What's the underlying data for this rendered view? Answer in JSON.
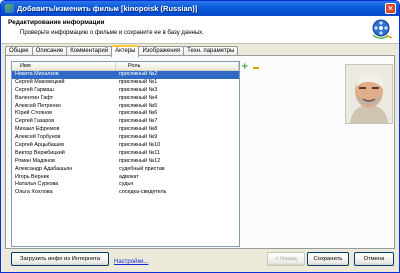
{
  "window": {
    "title": "Добавить/изменить фильм [kinopoisk (Russian)]"
  },
  "header": {
    "title": "Редактирование информации",
    "subtitle": "Проверьте информацию о фильме и сохраните ее в базу данных."
  },
  "tabs": [
    {
      "label": "Общее"
    },
    {
      "label": "Описание"
    },
    {
      "label": "Комментарий"
    },
    {
      "label": "Актеры",
      "active": true
    },
    {
      "label": "Изображения"
    },
    {
      "label": "Техн. параметры"
    }
  ],
  "list": {
    "columns": [
      "Имя",
      "Роль"
    ],
    "rows": [
      {
        "name": "Никита Михалков",
        "role": "присяжный №2",
        "selected": true
      },
      {
        "name": "Сергей Маковецкий",
        "role": "присяжный №1"
      },
      {
        "name": "Сергей Гармаш",
        "role": "присяжный №3"
      },
      {
        "name": "Валентин Гафт",
        "role": "присяжный №4"
      },
      {
        "name": "Алексей Петренко",
        "role": "присяжный №5"
      },
      {
        "name": "Юрий Стоянов",
        "role": "присяжный №6"
      },
      {
        "name": "Сергей Газаров",
        "role": "присяжный №7"
      },
      {
        "name": "Михаил Ефремов",
        "role": "присяжный №8"
      },
      {
        "name": "Алексей Горбунов",
        "role": "присяжный №9"
      },
      {
        "name": "Сергей Арцыбашев",
        "role": "присяжный №10"
      },
      {
        "name": "Виктор Вержбицкий",
        "role": "присяжный №11"
      },
      {
        "name": "Роман Мадянов",
        "role": "присяжный №12"
      },
      {
        "name": "Александр Адабашьян",
        "role": "судебный пристав"
      },
      {
        "name": "Игорь Верник",
        "role": "адвокат"
      },
      {
        "name": "Наталья Суркова",
        "role": "судья"
      },
      {
        "name": "Ольга Хохлова",
        "role": "соседка-свидетель"
      }
    ]
  },
  "icons": {
    "add": "plus-icon",
    "remove": "minus-icon"
  },
  "footer": {
    "load_button": "Загрузить инфо из Интернета",
    "settings_link": "Настройки...",
    "back_button": "< Назад",
    "save_button": "Сохранить",
    "cancel_button": "Отмена"
  },
  "colors": {
    "titlebar": "#0a5ddb",
    "selection": "#316ac5",
    "link": "#0b2fd1"
  }
}
